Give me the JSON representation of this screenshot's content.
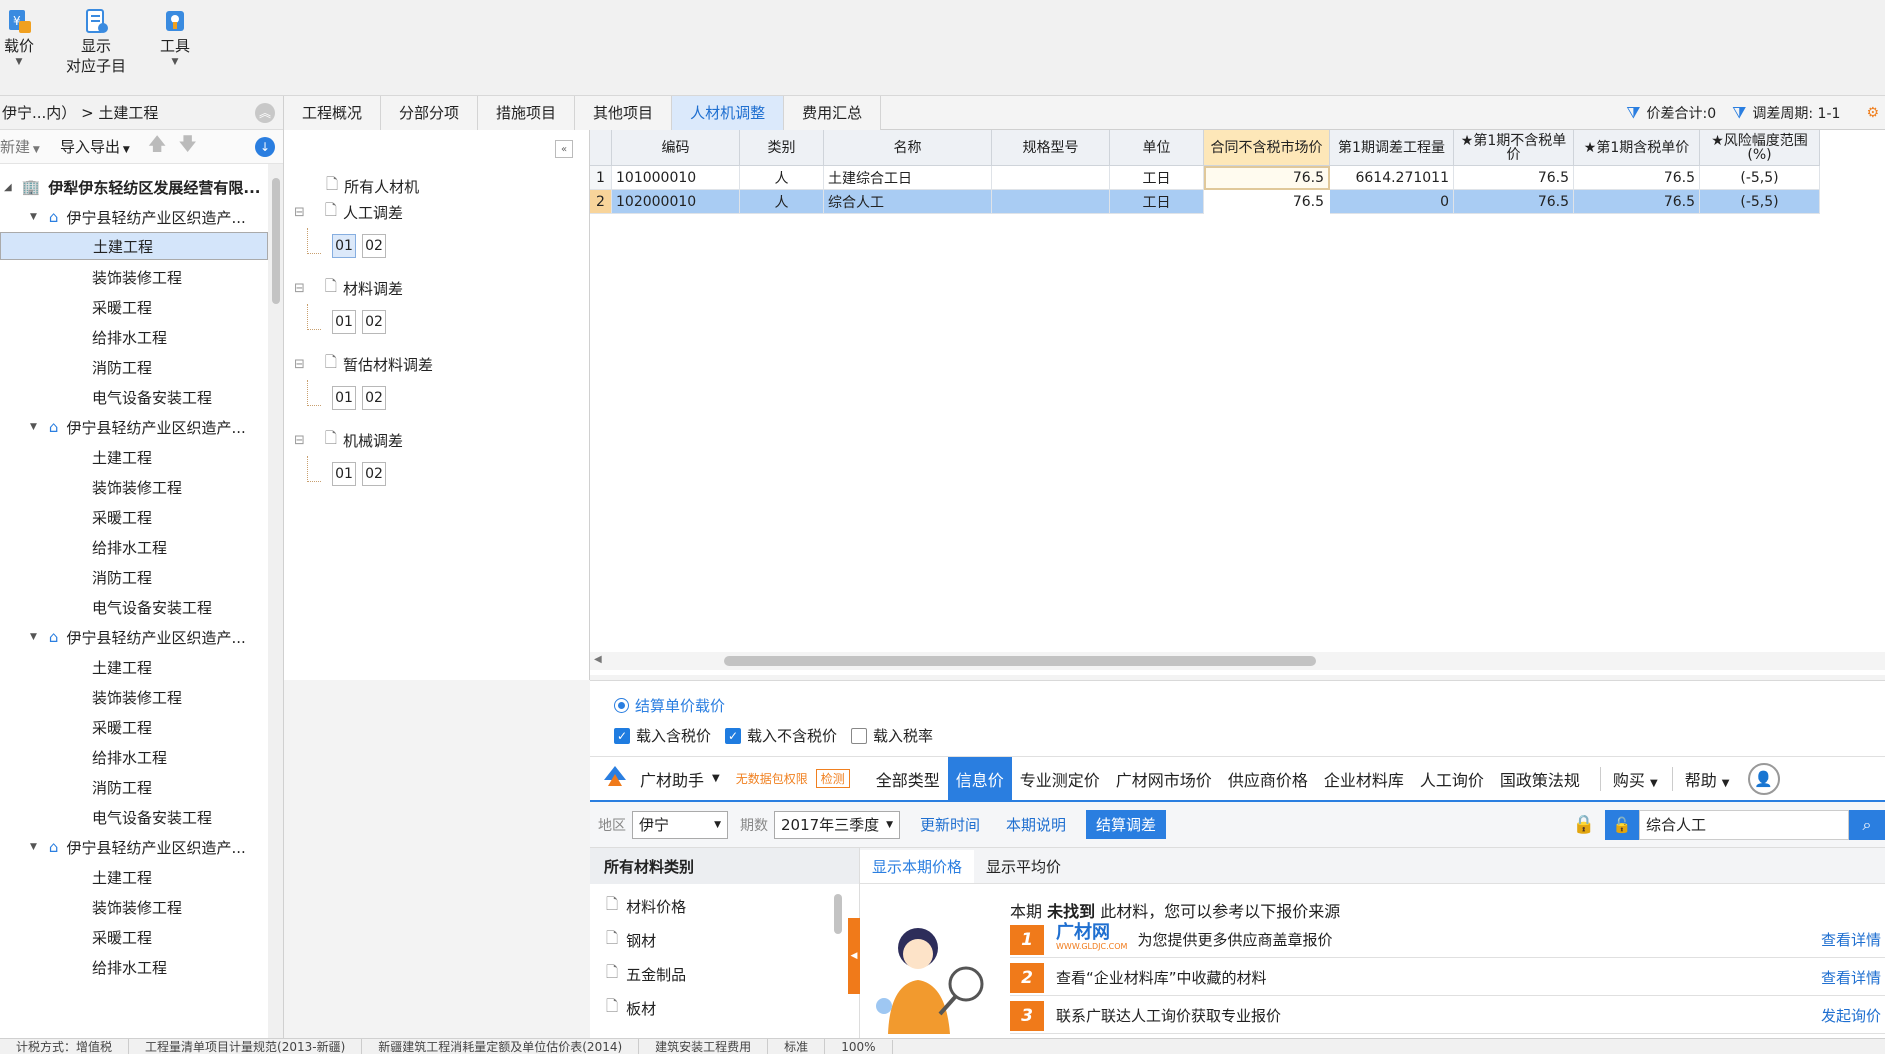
{
  "toolbar": {
    "buttons": [
      {
        "label": "载价"
      },
      {
        "label": "显示",
        "label2": "对应子目"
      },
      {
        "label": "工具"
      }
    ]
  },
  "left": {
    "breadcrumb": "伊宁...内） > 土建工程",
    "new_label": "新建",
    "import_label": "导入导出",
    "root": "伊犁伊东轻纺区发展经营有限...",
    "group_label": "伊宁县轻纺产业区织造产...",
    "children": [
      "土建工程",
      "装饰装修工程",
      "采暖工程",
      "给排水工程",
      "消防工程",
      "电气设备安装工程"
    ]
  },
  "tabs": [
    "工程概况",
    "分部分项",
    "措施项目",
    "其他项目",
    "人材机调整",
    "费用汇总"
  ],
  "summary": {
    "price_diff": "价差合计:0",
    "period": "调差周期: 1-1"
  },
  "mid": {
    "all": "所有人材机",
    "groups": [
      {
        "label": "人工调差",
        "b1": "01",
        "b2": "02"
      },
      {
        "label": "材料调差",
        "b1": "01",
        "b2": "02"
      },
      {
        "label": "暂估材料调差",
        "b1": "01",
        "b2": "02"
      },
      {
        "label": "机械调差",
        "b1": "01",
        "b2": "02"
      }
    ]
  },
  "grid": {
    "headers": [
      "编码",
      "类别",
      "名称",
      "规格型号",
      "单位",
      "合同不含税市场价",
      "第1期调差工程量",
      "★第1期不含税单价",
      "★第1期含税单价",
      "★风险幅度范围(%)"
    ],
    "rows": [
      {
        "no": "1",
        "code": "101000010",
        "cat": "人",
        "name": "土建综合工日",
        "spec": "",
        "unit": "工日",
        "price": "76.5",
        "qty": "6614.271011",
        "p1": "76.5",
        "p2": "76.5",
        "risk": "(-5,5)"
      },
      {
        "no": "2",
        "code": "102000010",
        "cat": "人",
        "name": "综合人工",
        "spec": "",
        "unit": "工日",
        "price": "76.5",
        "qty": "0",
        "p1": "76.5",
        "p2": "76.5",
        "risk": "(-5,5)"
      }
    ]
  },
  "options": {
    "radio": "结算单价载价",
    "cb1": "载入含税价",
    "cb2": "载入不含税价",
    "cb3": "载入税率"
  },
  "gcw": {
    "brand": "广材助手",
    "warn": "无数据包权限",
    "warn_tag": "检测",
    "tabs": [
      "全部类型",
      "信息价",
      "专业测定价",
      "广材网市场价",
      "供应商价格",
      "企业材料库",
      "人工询价",
      "国政策法规"
    ],
    "buy": "购买",
    "help": "帮助"
  },
  "filter": {
    "region_label": "地区",
    "region": "伊宁",
    "period_label": "期数",
    "period": "2017年三季度",
    "update": "更新时间",
    "explain": "本期说明",
    "settle": "结算调差",
    "search": "综合人工"
  },
  "cat": {
    "header": "所有材料类别",
    "items": [
      "材料价格",
      "钢材",
      "五金制品",
      "板材"
    ]
  },
  "info": {
    "tab1": "显示本期价格",
    "tab2": "显示平均价",
    "msg_pre": "本期",
    "msg_bold": "未找到",
    "msg_post": "此材料，您可以参考以下报价来源",
    "logo": "广材网",
    "logo_sub": "WWW.GLDJC.COM",
    "sources": [
      {
        "n": "1",
        "text": "为您提供更多供应商盖章报价",
        "link": "查看详情"
      },
      {
        "n": "2",
        "text": "查看“企业材料库”中收藏的材料",
        "link": "查看详情"
      },
      {
        "n": "3",
        "text": "联系广联达人工询价获取专业报价",
        "link": "发起询价"
      }
    ]
  },
  "status": [
    "计税方式：增值税",
    "工程量清单项目计量规范(2013-新疆)",
    "新疆建筑工程消耗量定额及单位估价表(2014)",
    "建筑安装工程费用",
    "标准",
    "100%"
  ]
}
